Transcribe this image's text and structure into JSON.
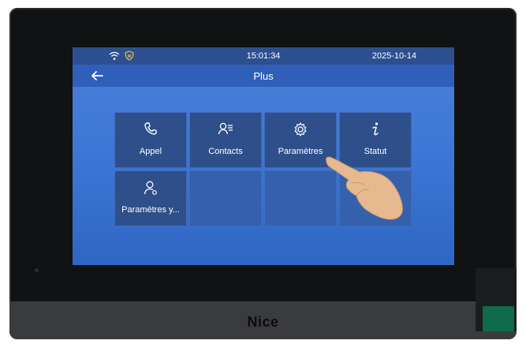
{
  "statusbar": {
    "time": "15:01:34",
    "date": "2025-10-14",
    "icons": [
      "wifi-icon",
      "shield-icon"
    ]
  },
  "header": {
    "title": "Plus",
    "back_icon": "back-arrow-icon"
  },
  "tiles": [
    {
      "label": "Appel",
      "icon": "phone-icon"
    },
    {
      "label": "Contacts",
      "icon": "contacts-icon"
    },
    {
      "label": "Paramètres",
      "icon": "gear-icon"
    },
    {
      "label": "Statut",
      "icon": "info-icon"
    },
    {
      "label": "Paramètres y...",
      "icon": "user-settings-icon"
    }
  ],
  "device": {
    "brand": "Nice"
  },
  "colors": {
    "screen": "#3e78d6",
    "tile": "#2f4f8a",
    "statusbar": "#2d4f8f",
    "bezel": "#111214",
    "led": "#0f6b4a"
  }
}
